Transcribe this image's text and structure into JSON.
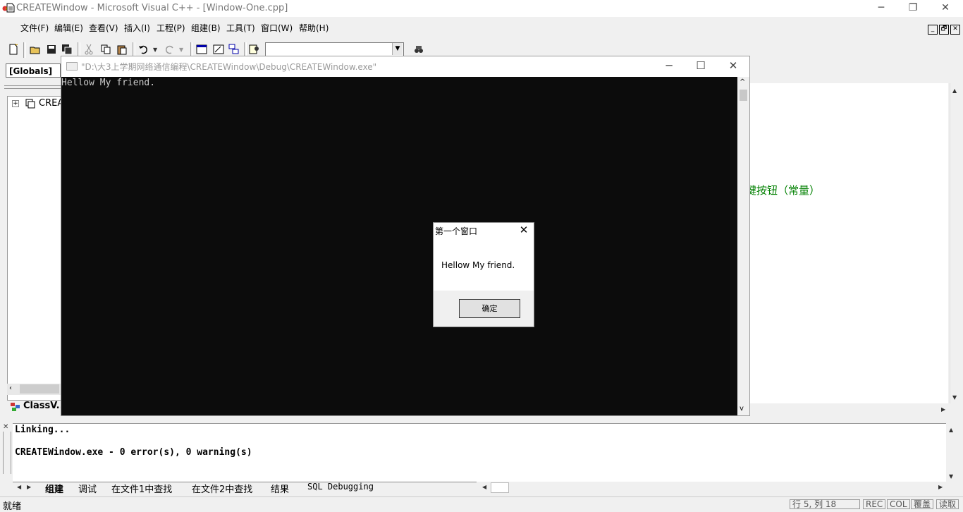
{
  "app": {
    "title": "CREATEWindow - Microsoft Visual C++ - [Window-One.cpp]",
    "window_controls": {
      "minimize": "─",
      "restore": "❐",
      "close": "✕"
    }
  },
  "menu": {
    "items": [
      "文件(F)",
      "编辑(E)",
      "查看(V)",
      "插入(I)",
      "工程(P)",
      "组建(B)",
      "工具(T)",
      "窗口(W)",
      "帮助(H)"
    ],
    "mdi_controls": [
      "_",
      "🗗",
      "✕"
    ]
  },
  "toolbar": {
    "find_combo_value": ""
  },
  "workspace": {
    "scope_combo": "[Globals]",
    "tree_expand": "+",
    "tree_root_label": "CREA",
    "tab_label": "ClassV..."
  },
  "editor": {
    "visible_text": "键按钮（常量）"
  },
  "console": {
    "title": "\"D:\\大3上学期网络通信编程\\CREATEWindow\\Debug\\CREATEWindow.exe\"",
    "output": "Hellow My friend.",
    "controls": {
      "minimize": "─",
      "maximize": "☐",
      "close": "✕"
    }
  },
  "message_box": {
    "title": "第一个窗口",
    "message": "Hellow My friend.",
    "ok_label": "确定",
    "close_glyph": "✕"
  },
  "output_pane": {
    "lines": [
      "Linking...",
      "",
      "CREATEWindow.exe - 0 error(s), 0 warning(s)"
    ],
    "tabs": [
      "组建",
      "调试",
      "在文件1中查找",
      "在文件2中查找",
      "结果",
      "SQL Debugging"
    ],
    "active_tab": "组建"
  },
  "statusbar": {
    "text": "就绪",
    "position": "行 5, 列 18",
    "indicators": [
      "REC",
      "COL",
      "覆盖",
      "读取"
    ]
  },
  "colors": {
    "console_bg": "#0c0c0c",
    "console_fg": "#cccccc",
    "comment_green": "#008000",
    "chrome": "#f0f0f0"
  }
}
